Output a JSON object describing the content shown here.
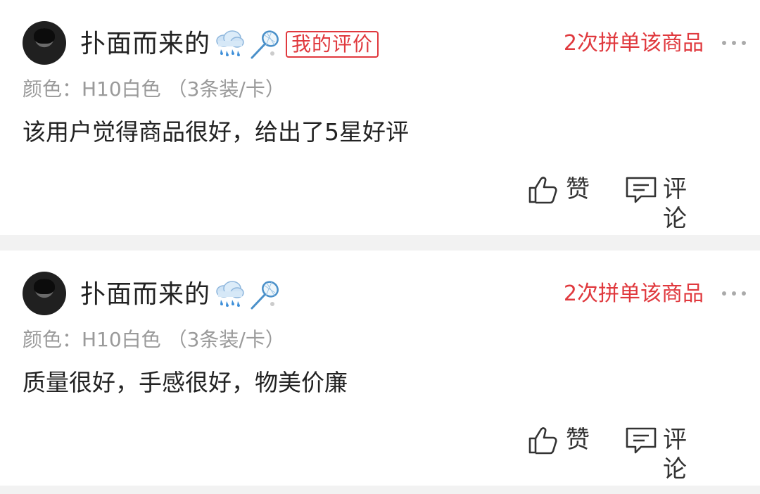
{
  "reviews": [
    {
      "username": "扑面而来的",
      "emoji_icons": [
        "cloud-rain-icon",
        "badminton-racket-icon"
      ],
      "my_review_tag": "我的评价",
      "buy_count": "2次拼单该商品",
      "spec": "颜色：H10白色 （3条装/卡）",
      "content": "该用户觉得商品很好，给出了5星好评",
      "like_label": "赞",
      "comment_label": "评论"
    },
    {
      "username": "扑面而来的",
      "emoji_icons": [
        "cloud-rain-icon",
        "badminton-racket-icon"
      ],
      "buy_count": "2次拼单该商品",
      "spec": "颜色：H10白色 （3条装/卡）",
      "content": "质量很好，手感很好，物美价廉",
      "like_label": "赞",
      "comment_label": "评论"
    }
  ],
  "colors": {
    "accent_red": "#e0393e",
    "text_primary": "#222222",
    "text_secondary": "#9a9a9a",
    "separator": "#f2f2f2"
  }
}
